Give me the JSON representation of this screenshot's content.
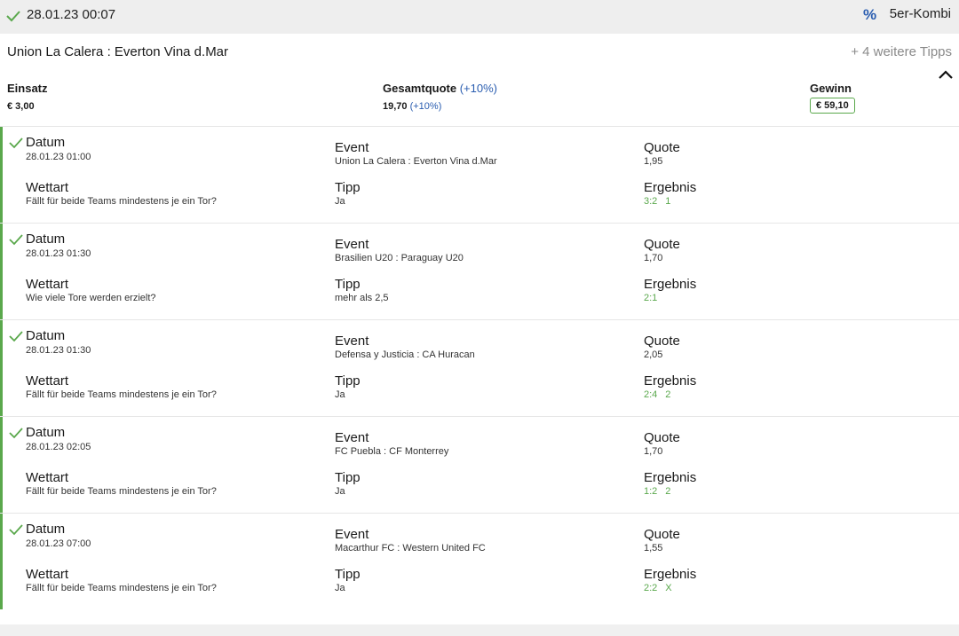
{
  "header": {
    "datetime": "28.01.23 00:07",
    "percent_icon": "%",
    "bet_type": "5er-Kombi"
  },
  "summary": {
    "match": "Union La Calera : Everton Vina d.Mar",
    "more_tipps": "+ 4 weitere Tipps",
    "einsatz_label": "Einsatz",
    "einsatz_value": "€ 3,00",
    "gesamtquote_label": "Gesamtquote",
    "gesamtquote_bonus": "(+10%)",
    "gesamtquote_value": "19,70",
    "gesamtquote_value_bonus": "(+10%)",
    "gewinn_label": "Gewinn",
    "gewinn_value": "€ 59,10"
  },
  "legs": [
    {
      "datum_label": "Datum",
      "datum": "28.01.23 01:00",
      "event_label": "Event",
      "event": "Union La Calera : Everton Vina d.Mar",
      "quote_label": "Quote",
      "quote": "1,95",
      "wettart_label": "Wettart",
      "wettart": "Fällt für beide Teams mindestens je ein Tor?",
      "tipp_label": "Tipp",
      "tipp": "Ja",
      "ergebnis_label": "Ergebnis",
      "ergebnis_score": "3:2",
      "ergebnis_outcome": "1"
    },
    {
      "datum_label": "Datum",
      "datum": "28.01.23 01:30",
      "event_label": "Event",
      "event": "Brasilien U20 : Paraguay U20",
      "quote_label": "Quote",
      "quote": "1,70",
      "wettart_label": "Wettart",
      "wettart": "Wie viele Tore werden erzielt?",
      "tipp_label": "Tipp",
      "tipp": "mehr als 2,5",
      "ergebnis_label": "Ergebnis",
      "ergebnis_score": "2:1",
      "ergebnis_outcome": ""
    },
    {
      "datum_label": "Datum",
      "datum": "28.01.23 01:30",
      "event_label": "Event",
      "event": "Defensa y Justicia : CA Huracan",
      "quote_label": "Quote",
      "quote": "2,05",
      "wettart_label": "Wettart",
      "wettart": "Fällt für beide Teams mindestens je ein Tor?",
      "tipp_label": "Tipp",
      "tipp": "Ja",
      "ergebnis_label": "Ergebnis",
      "ergebnis_score": "2:4",
      "ergebnis_outcome": "2"
    },
    {
      "datum_label": "Datum",
      "datum": "28.01.23 02:05",
      "event_label": "Event",
      "event": "FC Puebla : CF Monterrey",
      "quote_label": "Quote",
      "quote": "1,70",
      "wettart_label": "Wettart",
      "wettart": "Fällt für beide Teams mindestens je ein Tor?",
      "tipp_label": "Tipp",
      "tipp": "Ja",
      "ergebnis_label": "Ergebnis",
      "ergebnis_score": "1:2",
      "ergebnis_outcome": "2"
    },
    {
      "datum_label": "Datum",
      "datum": "28.01.23 07:00",
      "event_label": "Event",
      "event": "Macarthur FC : Western United FC",
      "quote_label": "Quote",
      "quote": "1,55",
      "wettart_label": "Wettart",
      "wettart": "Fällt für beide Teams mindestens je ein Tor?",
      "tipp_label": "Tipp",
      "tipp": "Ja",
      "ergebnis_label": "Ergebnis",
      "ergebnis_score": "2:2",
      "ergebnis_outcome": "X"
    }
  ],
  "colors": {
    "accent_green": "#5aa84c",
    "accent_blue": "#2a5db0"
  }
}
